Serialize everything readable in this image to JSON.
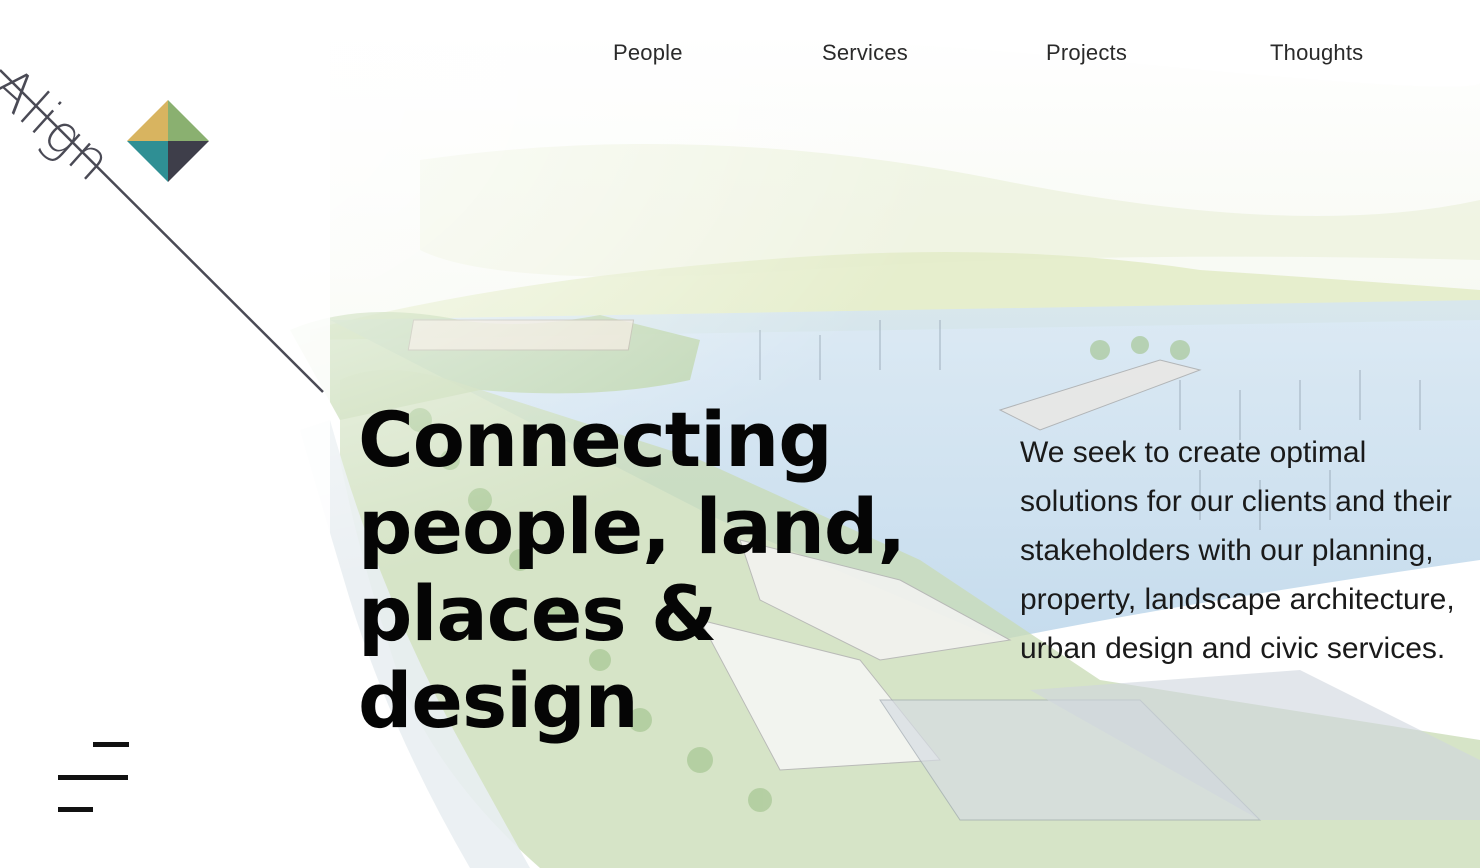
{
  "brand": {
    "logo_text": "Align",
    "colors": {
      "mark_top": "#d8b460",
      "mark_right": "#8ab070",
      "mark_left": "#2f8f94",
      "mark_bottom": "#3e3e4a",
      "line": "#4a4a55"
    }
  },
  "nav": {
    "items": [
      {
        "label": "People"
      },
      {
        "label": "Services"
      },
      {
        "label": "Projects"
      },
      {
        "label": "Thoughts"
      }
    ]
  },
  "hero": {
    "headline_lines": [
      "Connecting",
      "people, land,",
      "places &",
      "design"
    ],
    "description": "We seek to create optimal solutions for our clients and their stakeholders with our planning, property, landscape architecture, urban design and civic services.",
    "background": "watercolour-waterfront-sketch"
  },
  "menu": {
    "icon": "hamburger-menu-icon"
  }
}
